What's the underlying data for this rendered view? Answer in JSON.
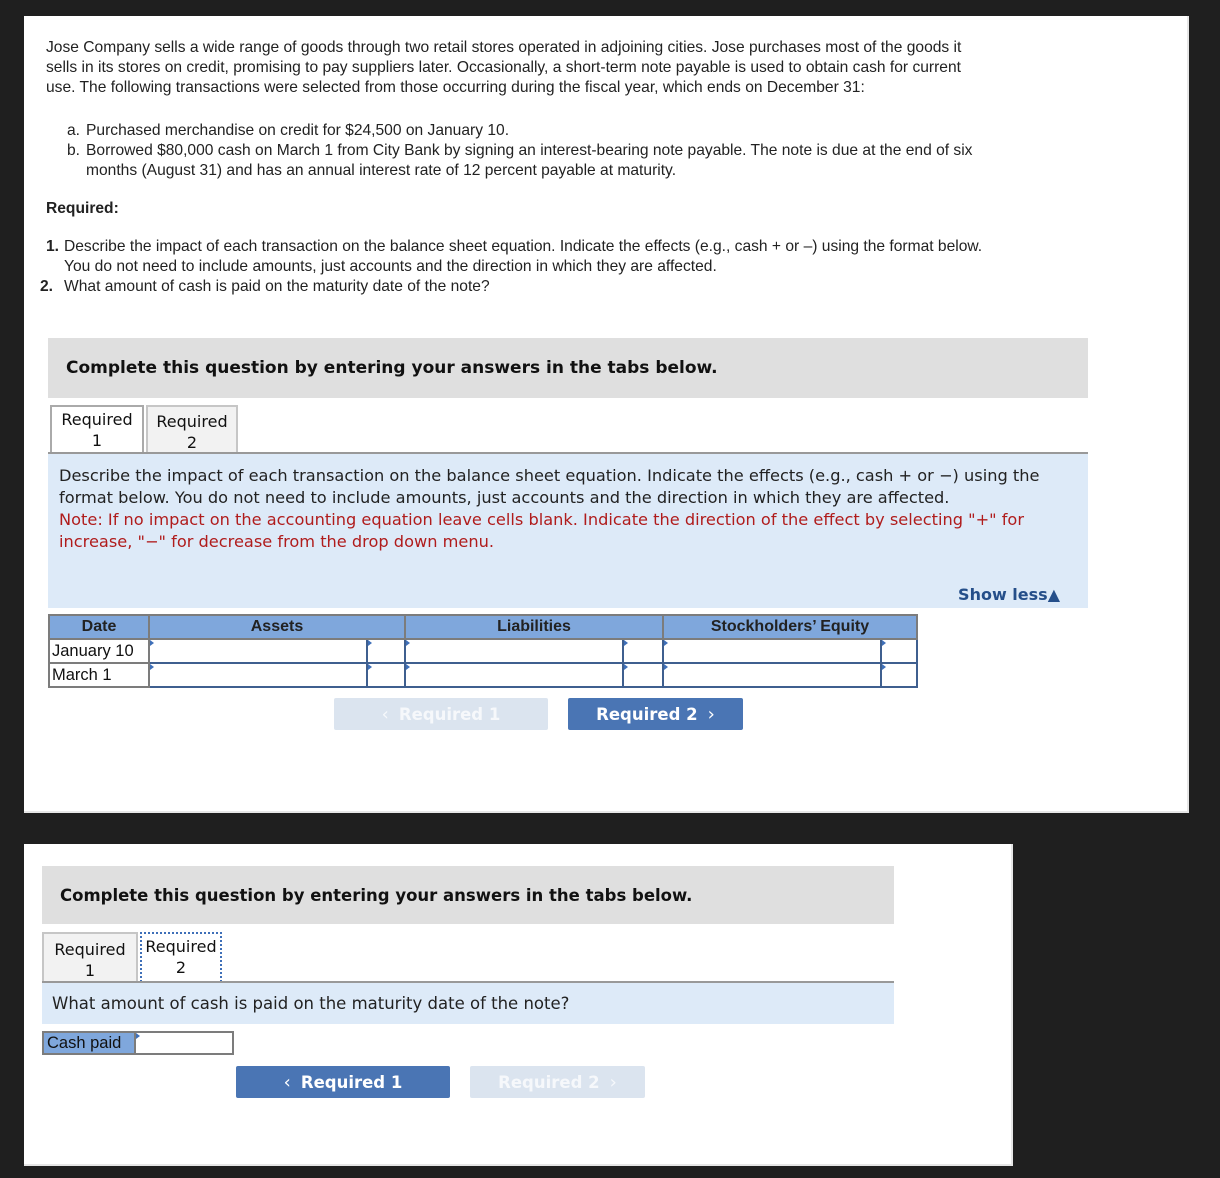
{
  "problem": {
    "intro": "Jose Company sells a wide range of goods through two retail stores operated in adjoining cities. Jose purchases most of the goods it sells in its stores on credit, promising to pay suppliers later. Occasionally, a short-term note payable is used to obtain cash for current use. The following transactions were selected from those occurring during the fiscal year, which ends on December 31:",
    "transactions": [
      {
        "marker": "a.",
        "text": "Purchased merchandise on credit for $24,500 on January 10."
      },
      {
        "marker": "b.",
        "text": "Borrowed $80,000 cash on March 1 from City Bank by signing an interest-bearing note payable. The note is due at the end of six months (August 31) and has an annual interest rate of 12 percent payable at maturity."
      }
    ],
    "required_heading": "Required:",
    "requirements": [
      {
        "marker": "1.",
        "text": "Describe the impact of each transaction on the balance sheet equation. Indicate the effects (e.g., cash + or –) using the format below. You do not need to include amounts, just accounts and the direction in which they are affected."
      },
      {
        "marker": "2.",
        "text": "What amount of cash is paid on the maturity date of the note?"
      }
    ]
  },
  "panel1": {
    "banner": "Complete this question by entering your answers in the tabs below.",
    "tabs": [
      {
        "line1": "Required",
        "line2": "1",
        "state": "active"
      },
      {
        "line1": "Required",
        "line2": "2",
        "state": "inactive"
      }
    ],
    "instruction": "Describe the impact of each transaction on the balance sheet equation. Indicate the effects (e.g., cash + or −) using the format below. You do not need to include amounts, just accounts and the direction in which they are affected.",
    "note": "Note: If no impact on the accounting equation leave cells blank. Indicate the direction of the effect by selecting \"+\" for increase, \"−\" for decrease from the drop down menu.",
    "show_less": "Show less",
    "show_less_icon": "▲",
    "table": {
      "headers": [
        "Date",
        "Assets",
        "Liabilities",
        "Stockholders’ Equity"
      ],
      "rows": [
        {
          "date": "January 10",
          "assets_account": "",
          "assets_sign": "",
          "liabilities_account": "",
          "liabilities_sign": "",
          "equity_account": "",
          "equity_sign": ""
        },
        {
          "date": "March 1",
          "assets_account": "",
          "assets_sign": "",
          "liabilities_account": "",
          "liabilities_sign": "",
          "equity_account": "",
          "equity_sign": ""
        }
      ]
    },
    "prev_button": {
      "label": "Required 1",
      "icon": "‹",
      "enabled": false
    },
    "next_button": {
      "label": "Required 2",
      "icon": "›",
      "enabled": true
    }
  },
  "panel2": {
    "banner": "Complete this question by entering your answers in the tabs below.",
    "tabs": [
      {
        "line1": "Required",
        "line2": "1",
        "state": "inactive"
      },
      {
        "line1": "Required",
        "line2": "2",
        "state": "active"
      }
    ],
    "instruction": "What amount of cash is paid on the maturity date of the note?",
    "cash_label": "Cash paid",
    "cash_value": "",
    "prev_button": {
      "label": "Required 1",
      "icon": "‹",
      "enabled": true
    },
    "next_button": {
      "label": "Required 2",
      "icon": "›",
      "enabled": false
    }
  },
  "colors": {
    "page_bg": "#1f1f1f",
    "banner_bg": "#dfdfdf",
    "instruction_bg": "#ddeaf8",
    "note_red": "#b01c1c",
    "header_blue": "#7fa7dc",
    "button_blue": "#4a75b4",
    "button_disabled": "#dbe4ef",
    "link_blue": "#254f8a"
  }
}
